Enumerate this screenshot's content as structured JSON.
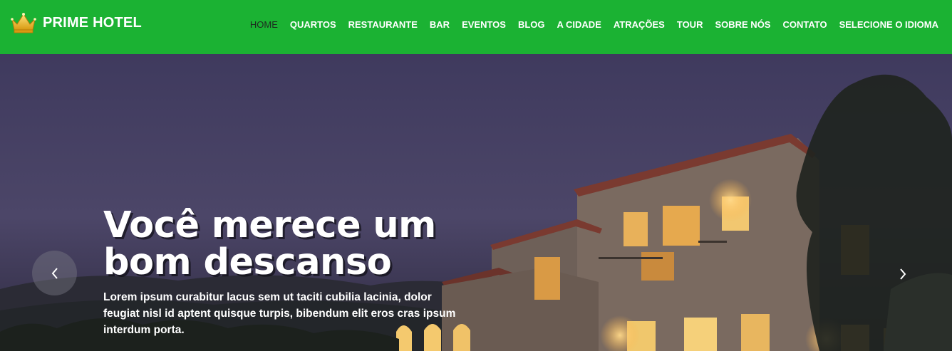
{
  "header": {
    "brand_name": "PRIME HOTEL",
    "logo_icon": "crown-icon",
    "nav_items": [
      {
        "label": "HOME",
        "active": true
      },
      {
        "label": "QUARTOS"
      },
      {
        "label": "RESTAURANTE"
      },
      {
        "label": "BAR"
      },
      {
        "label": "EVENTOS"
      },
      {
        "label": "BLOG"
      },
      {
        "label": "A CIDADE"
      },
      {
        "label": "ATRAÇÕES"
      },
      {
        "label": "TOUR"
      },
      {
        "label": "SOBRE NÓS"
      },
      {
        "label": "CONTATO"
      },
      {
        "label": "SELECIONE O IDIOMA"
      }
    ]
  },
  "hero": {
    "title": "Você merece um bom descanso",
    "text": "Lorem ipsum curabitur lacus sem ut taciti cubilia lacinia, dolor feugiat nisl id aptent quisque turpis, bibendum elit eros cras ipsum interdum porta.",
    "prev_icon": "chevron-left-icon",
    "next_icon": "chevron-right-icon"
  },
  "colors": {
    "navbar_bg": "#1bb233",
    "active_nav_text": "#1d2a1f",
    "text": "#ffffff"
  }
}
